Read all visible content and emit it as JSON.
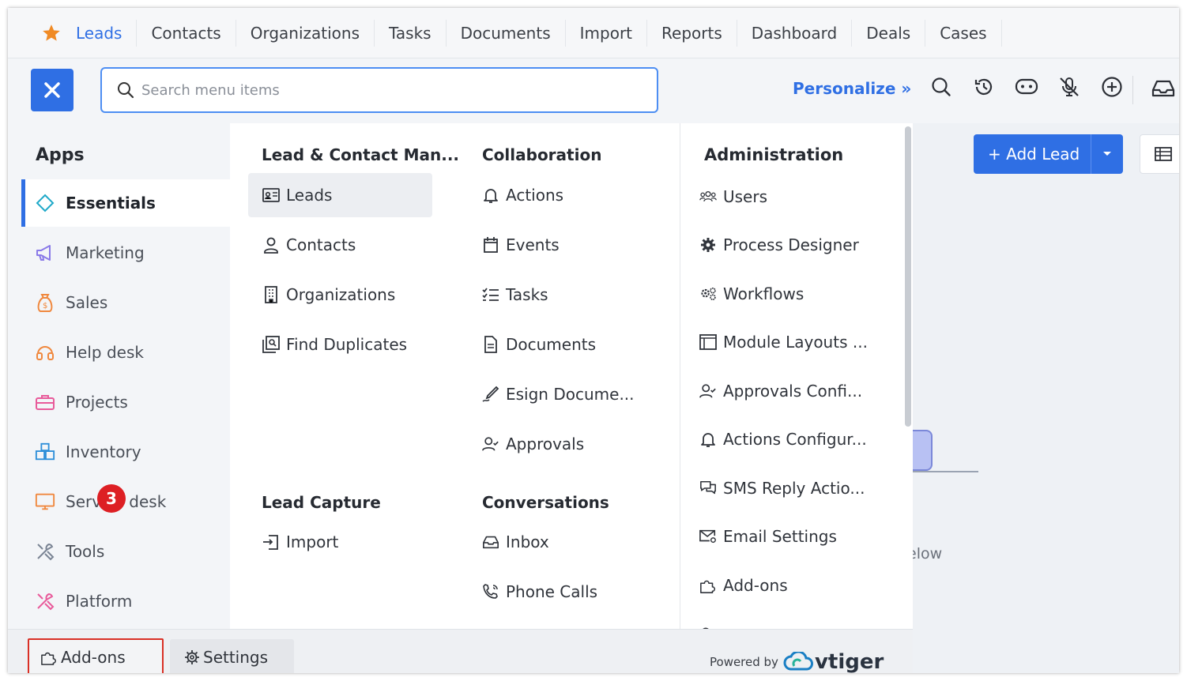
{
  "topnav": {
    "tabs": [
      "Leads",
      "Contacts",
      "Organizations",
      "Tasks",
      "Documents",
      "Import",
      "Reports",
      "Dashboard",
      "Deals",
      "Cases"
    ],
    "active_tab": "Leads"
  },
  "header": {
    "search_placeholder": "Search menu items",
    "personalize_label": "Personalize »"
  },
  "page": {
    "add_lead_label": "+ Add Lead",
    "background_text": "elow"
  },
  "sidebar": {
    "title": "Apps",
    "items": [
      {
        "label": "Essentials",
        "icon": "diamond-icon"
      },
      {
        "label": "Marketing",
        "icon": "megaphone-icon"
      },
      {
        "label": "Sales",
        "icon": "money-bag-icon"
      },
      {
        "label": "Help desk",
        "icon": "headset-icon"
      },
      {
        "label": "Projects",
        "icon": "briefcase-icon"
      },
      {
        "label": "Inventory",
        "icon": "boxes-icon"
      },
      {
        "label": "Service desk",
        "icon": "monitor-icon"
      },
      {
        "label": "Tools",
        "icon": "tools-icon"
      },
      {
        "label": "Platform",
        "icon": "platform-tools-icon"
      }
    ],
    "active": "Essentials"
  },
  "columns": {
    "lead_contact": {
      "title": "Lead & Contact Man...",
      "items": [
        "Leads",
        "Contacts",
        "Organizations",
        "Find Duplicates"
      ]
    },
    "lead_capture": {
      "title": "Lead Capture",
      "items": [
        "Import"
      ]
    },
    "collaboration": {
      "title": "Collaboration",
      "items": [
        "Actions",
        "Events",
        "Tasks",
        "Documents",
        "Esign Docume...",
        "Approvals"
      ]
    },
    "conversations": {
      "title": "Conversations",
      "items": [
        "Inbox",
        "Phone Calls"
      ]
    },
    "administration": {
      "title": "Administration",
      "items": [
        "Users",
        "Process Designer",
        "Workflows",
        "Module Layouts ...",
        "Approvals Confi...",
        "Actions Configur...",
        "SMS Reply Actio...",
        "Email Settings",
        "Add-ons"
      ]
    }
  },
  "bottombar": {
    "addons_label": "Add-ons",
    "settings_label": "Settings",
    "powered_by": "Powered by",
    "brand": "vtiger",
    "badge_number": "3"
  },
  "colors": {
    "accent": "#2f6fe4",
    "highlight_border": "#d93025",
    "badge": "#dd1f24"
  }
}
